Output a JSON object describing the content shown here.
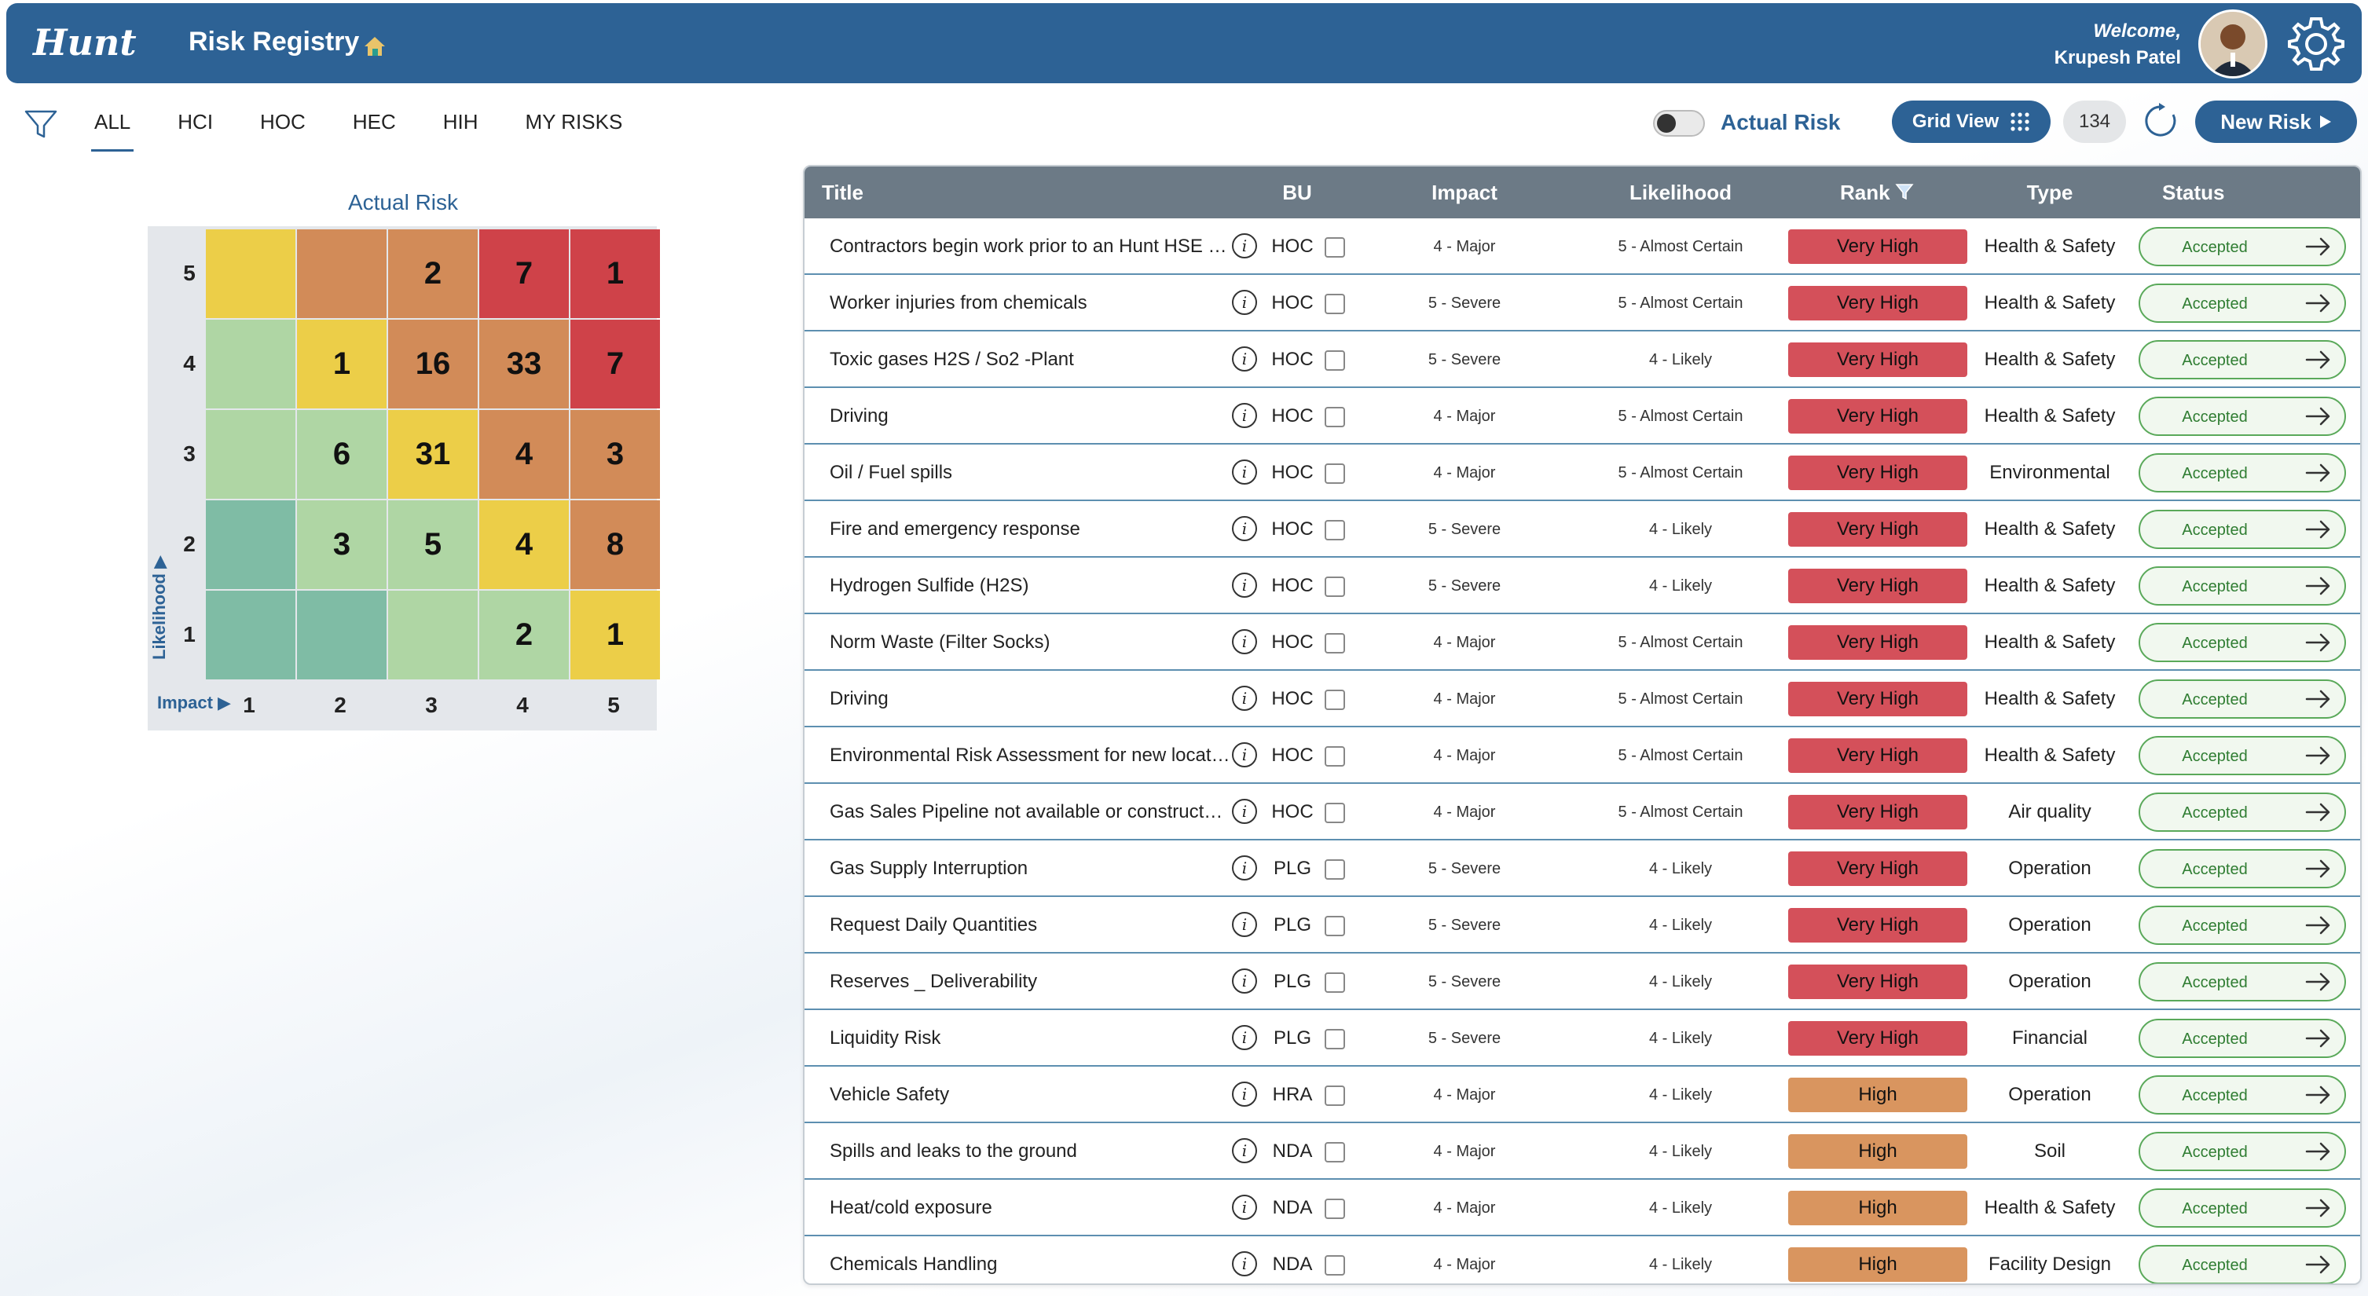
{
  "header": {
    "logo_text": "Hunt",
    "title": "Risk Registry",
    "welcome": "Welcome,",
    "user_name": "Krupesh Patel"
  },
  "tabs": [
    {
      "label": "ALL",
      "active": true
    },
    {
      "label": "HCI",
      "active": false
    },
    {
      "label": "HOC",
      "active": false
    },
    {
      "label": "HEC",
      "active": false
    },
    {
      "label": "HIH",
      "active": false
    },
    {
      "label": "MY RISKS",
      "active": false
    }
  ],
  "controls": {
    "toggle_label": "Actual Risk",
    "grid_view_label": "Grid View",
    "count": "134",
    "new_risk_label": "New Risk"
  },
  "matrix": {
    "title": "Actual Risk",
    "likelihood_label": "Likelihood",
    "impact_label": "Impact",
    "row_labels": [
      "5",
      "4",
      "3",
      "2",
      "1"
    ],
    "col_labels": [
      "1",
      "2",
      "3",
      "4",
      "5"
    ],
    "colors": {
      "yellow": "#ecce48",
      "orange": "#d28b58",
      "red": "#cf4249",
      "light_green": "#afd6a4",
      "teal": "#7fbca5"
    },
    "cells": [
      [
        {
          "v": "",
          "c": "yellow"
        },
        {
          "v": "",
          "c": "orange"
        },
        {
          "v": "2",
          "c": "orange"
        },
        {
          "v": "7",
          "c": "red"
        },
        {
          "v": "1",
          "c": "red"
        }
      ],
      [
        {
          "v": "",
          "c": "light_green"
        },
        {
          "v": "1",
          "c": "yellow"
        },
        {
          "v": "16",
          "c": "orange"
        },
        {
          "v": "33",
          "c": "orange"
        },
        {
          "v": "7",
          "c": "red"
        }
      ],
      [
        {
          "v": "",
          "c": "light_green"
        },
        {
          "v": "6",
          "c": "light_green"
        },
        {
          "v": "31",
          "c": "yellow"
        },
        {
          "v": "4",
          "c": "orange"
        },
        {
          "v": "3",
          "c": "orange"
        }
      ],
      [
        {
          "v": "",
          "c": "teal"
        },
        {
          "v": "3",
          "c": "light_green"
        },
        {
          "v": "5",
          "c": "light_green"
        },
        {
          "v": "4",
          "c": "yellow"
        },
        {
          "v": "8",
          "c": "orange"
        }
      ],
      [
        {
          "v": "",
          "c": "teal"
        },
        {
          "v": "",
          "c": "teal"
        },
        {
          "v": "",
          "c": "light_green"
        },
        {
          "v": "2",
          "c": "light_green"
        },
        {
          "v": "1",
          "c": "yellow"
        }
      ]
    ]
  },
  "table": {
    "columns": [
      "Title",
      "BU",
      "Impact",
      "Likelihood",
      "Rank",
      "Type",
      "Status"
    ],
    "rank_colors": {
      "Very High": "#d4505a",
      "High": "#d9955f"
    },
    "rows": [
      {
        "title": "Contractors begin work prior to an Hunt HSE approval",
        "bu": "HOC",
        "impact": "4 - Major",
        "likelihood": "5 - Almost Certain",
        "rank": "Very High",
        "type": "Health & Safety",
        "status": "Accepted"
      },
      {
        "title": "Worker injuries from chemicals",
        "bu": "HOC",
        "impact": "5 - Severe",
        "likelihood": "5 - Almost Certain",
        "rank": "Very High",
        "type": "Health & Safety",
        "status": "Accepted"
      },
      {
        "title": "Toxic gases H2S / So2 -Plant",
        "bu": "HOC",
        "impact": "5 - Severe",
        "likelihood": "4 - Likely",
        "rank": "Very High",
        "type": "Health & Safety",
        "status": "Accepted"
      },
      {
        "title": "Driving",
        "bu": "HOC",
        "impact": "4 - Major",
        "likelihood": "5 - Almost Certain",
        "rank": "Very High",
        "type": "Health & Safety",
        "status": "Accepted"
      },
      {
        "title": "Oil / Fuel spills",
        "bu": "HOC",
        "impact": "4 - Major",
        "likelihood": "5 - Almost Certain",
        "rank": "Very High",
        "type": "Environmental",
        "status": "Accepted"
      },
      {
        "title": "Fire and emergency response",
        "bu": "HOC",
        "impact": "5 - Severe",
        "likelihood": "4 - Likely",
        "rank": "Very High",
        "type": "Health & Safety",
        "status": "Accepted"
      },
      {
        "title": "Hydrogen Sulfide (H2S)",
        "bu": "HOC",
        "impact": "5 - Severe",
        "likelihood": "4 - Likely",
        "rank": "Very High",
        "type": "Health & Safety",
        "status": "Accepted"
      },
      {
        "title": "Norm Waste (Filter Socks)",
        "bu": "HOC",
        "impact": "4 - Major",
        "likelihood": "5 - Almost Certain",
        "rank": "Very High",
        "type": "Health & Safety",
        "status": "Accepted"
      },
      {
        "title": "Driving",
        "bu": "HOC",
        "impact": "4 - Major",
        "likelihood": "5 - Almost Certain",
        "rank": "Very High",
        "type": "Health & Safety",
        "status": "Accepted"
      },
      {
        "title": "Environmental Risk Assessment for new location",
        "bu": "HOC",
        "impact": "4 - Major",
        "likelihood": "5 - Almost Certain",
        "rank": "Very High",
        "type": "Health & Safety",
        "status": "Accepted"
      },
      {
        "title": "Gas Sales Pipeline not available or constructed in time",
        "bu": "HOC",
        "impact": "4 - Major",
        "likelihood": "5 - Almost Certain",
        "rank": "Very High",
        "type": "Air quality",
        "status": "Accepted"
      },
      {
        "title": "Gas Supply Interruption",
        "bu": "PLG",
        "impact": "5 - Severe",
        "likelihood": "4 - Likely",
        "rank": "Very High",
        "type": "Operation",
        "status": "Accepted"
      },
      {
        "title": "Request Daily Quantities",
        "bu": "PLG",
        "impact": "5 - Severe",
        "likelihood": "4 - Likely",
        "rank": "Very High",
        "type": "Operation",
        "status": "Accepted"
      },
      {
        "title": "Reserves _ Deliverability",
        "bu": "PLG",
        "impact": "5 - Severe",
        "likelihood": "4 - Likely",
        "rank": "Very High",
        "type": "Operation",
        "status": "Accepted"
      },
      {
        "title": "Liquidity Risk",
        "bu": "PLG",
        "impact": "5 - Severe",
        "likelihood": "4 - Likely",
        "rank": "Very High",
        "type": "Financial",
        "status": "Accepted"
      },
      {
        "title": "Vehicle Safety",
        "bu": "HRA",
        "impact": "4 - Major",
        "likelihood": "4 - Likely",
        "rank": "High",
        "type": "Operation",
        "status": "Accepted"
      },
      {
        "title": "Spills and leaks to the ground",
        "bu": "NDA",
        "impact": "4 - Major",
        "likelihood": "4 - Likely",
        "rank": "High",
        "type": "Soil",
        "status": "Accepted"
      },
      {
        "title": "Heat/cold exposure",
        "bu": "NDA",
        "impact": "4 - Major",
        "likelihood": "4 - Likely",
        "rank": "High",
        "type": "Health & Safety",
        "status": "Accepted"
      },
      {
        "title": "Chemicals Handling",
        "bu": "NDA",
        "impact": "4 - Major",
        "likelihood": "4 - Likely",
        "rank": "High",
        "type": "Facility Design",
        "status": "Accepted"
      }
    ]
  }
}
